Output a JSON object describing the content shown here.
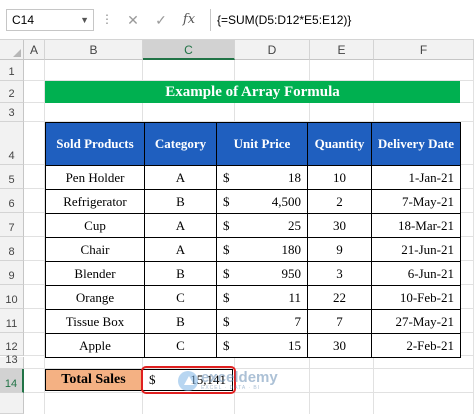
{
  "formula_bar": {
    "name_box": "C14",
    "dots": "⋮",
    "cancel_icon": "✕",
    "enter_icon": "✓",
    "fx_label": "fx",
    "formula": "{=SUM(D5:D12*E5:E12)}"
  },
  "columns": [
    "A",
    "B",
    "C",
    "D",
    "E",
    "F"
  ],
  "selected_column": "C",
  "rows": [
    "1",
    "2",
    "3",
    "4",
    "5",
    "6",
    "7",
    "8",
    "9",
    "10",
    "11",
    "12",
    "13",
    "14"
  ],
  "selected_row": "14",
  "title": "Example of Array Formula",
  "table": {
    "headers": [
      "Sold Products",
      "Category",
      "Unit Price",
      "Quantity",
      "Delivery Date"
    ],
    "rows": [
      {
        "product": "Pen Holder",
        "category": "A",
        "currency": "$",
        "price": "18",
        "qty": "10",
        "date": "1-Jan-21"
      },
      {
        "product": "Refrigerator",
        "category": "B",
        "currency": "$",
        "price": "4,500",
        "qty": "2",
        "date": "7-May-21"
      },
      {
        "product": "Cup",
        "category": "A",
        "currency": "$",
        "price": "25",
        "qty": "30",
        "date": "18-Mar-21"
      },
      {
        "product": "Chair",
        "category": "A",
        "currency": "$",
        "price": "180",
        "qty": "9",
        "date": "21-Jun-21"
      },
      {
        "product": "Blender",
        "category": "B",
        "currency": "$",
        "price": "950",
        "qty": "3",
        "date": "6-Jun-21"
      },
      {
        "product": "Orange",
        "category": "C",
        "currency": "$",
        "price": "11",
        "qty": "22",
        "date": "10-Feb-21"
      },
      {
        "product": "Tissue Box",
        "category": "B",
        "currency": "$",
        "price": "7",
        "qty": "7",
        "date": "27-May-21"
      },
      {
        "product": "Apple",
        "category": "C",
        "currency": "$",
        "price": "15",
        "qty": "30",
        "date": "2-Feb-21"
      }
    ]
  },
  "total": {
    "label": "Total Sales",
    "currency": "$",
    "value": "15,141"
  },
  "watermark": {
    "name": "exceldemy",
    "tagline": "EXCEL · DATA · BI"
  },
  "colors": {
    "title_bg": "#00b050",
    "header_bg": "#1f5fbf",
    "total_label_bg": "#f4b183",
    "highlight": "#e02020",
    "excel_green": "#217346"
  }
}
